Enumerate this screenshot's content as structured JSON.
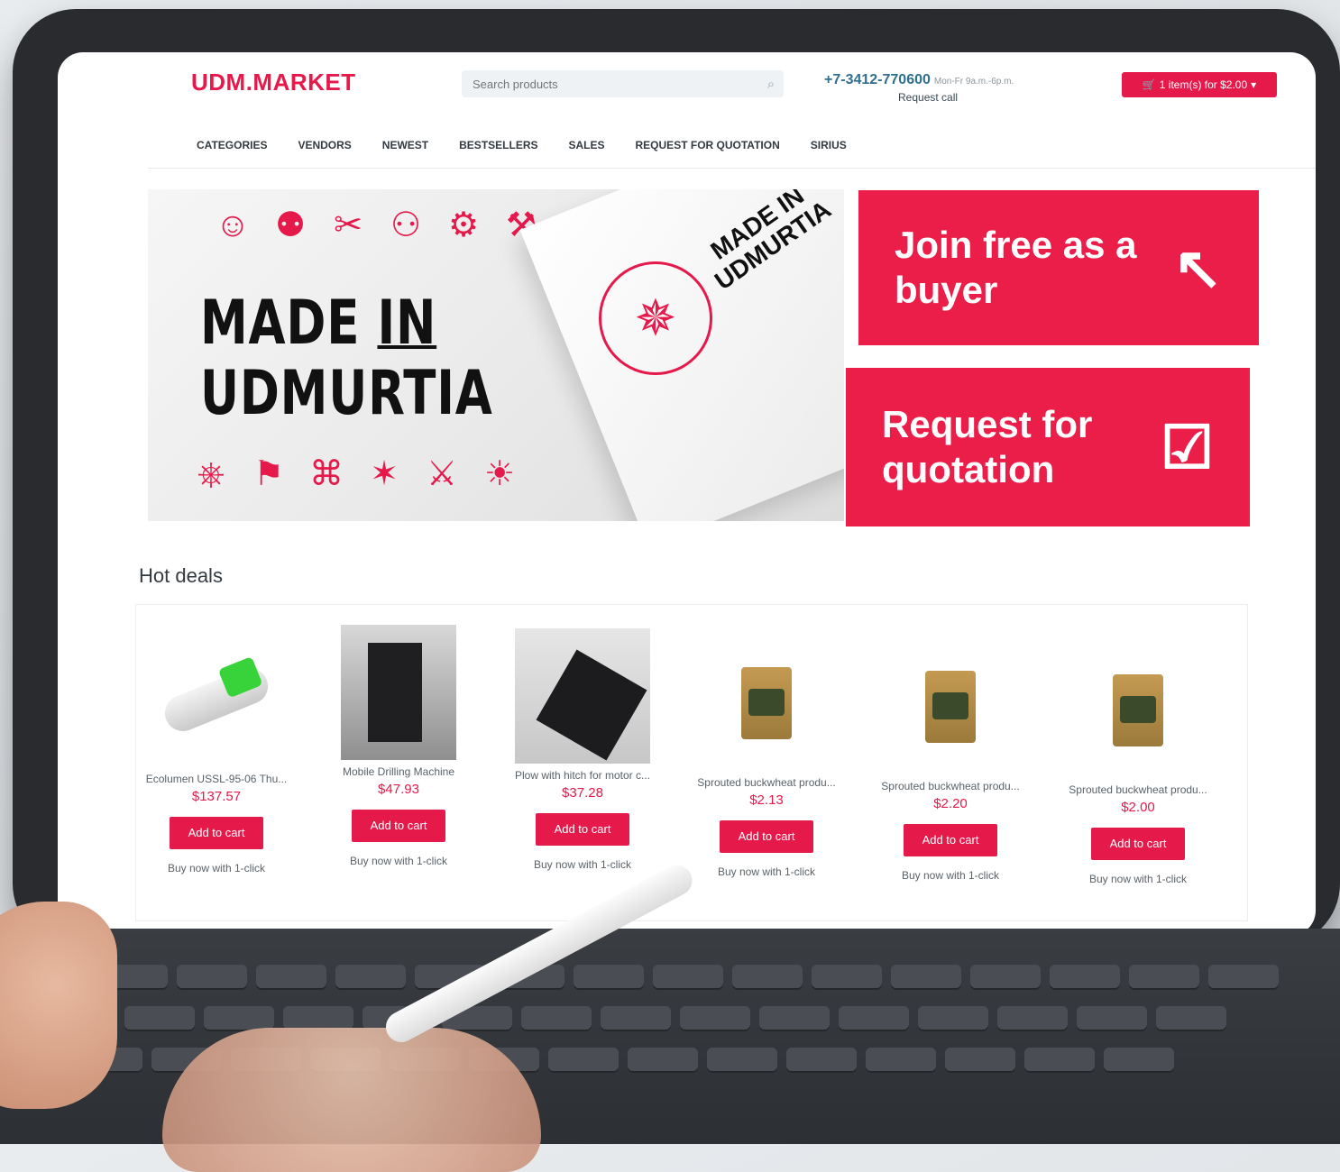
{
  "header": {
    "logo": "UDM.MARKET",
    "search_placeholder": "Search products",
    "phone": "+7-3412-770600",
    "hours": "Mon-Fr 9a.m.-6p.m.",
    "request_call": "Request call",
    "cart": "1 item(s) for $2.00"
  },
  "nav": [
    "CATEGORIES",
    "VENDORS",
    "NEWEST",
    "BESTSELLERS",
    "SALES",
    "REQUEST FOR QUOTATION",
    "SIRIUS"
  ],
  "banner": {
    "line1": "MADE",
    "in": "IN",
    "line2": "UDMURTIA",
    "box_text": "MADE IN\nUDMURTIA",
    "stamp_top": "MADE IN",
    "stamp_bottom": "UDMURTIA"
  },
  "promos": [
    {
      "text": "Join free as a buyer",
      "icon": "cursor-click-icon"
    },
    {
      "text": "Request for quotation",
      "icon": "checklist-icon"
    }
  ],
  "hot_deals": {
    "title": "Hot deals",
    "products": [
      {
        "name": "Ecolumen USSL-95-06 Thu...",
        "price": "$137.57",
        "button": "Add to cart",
        "buy": "Buy now with 1-click"
      },
      {
        "name": "Mobile Drilling Machine",
        "price": "$47.93",
        "button": "Add to cart",
        "buy": "Buy now with 1-click"
      },
      {
        "name": "Plow with hitch for motor c...",
        "price": "$37.28",
        "button": "Add to cart",
        "buy": "Buy now with 1-click"
      },
      {
        "name": "Sprouted buckwheat produ...",
        "price": "$2.13",
        "button": "Add to cart",
        "buy": "Buy now with 1-click"
      },
      {
        "name": "Sprouted buckwheat produ...",
        "price": "$2.20",
        "button": "Add to cart",
        "buy": "Buy now with 1-click"
      },
      {
        "name": "Sprouted buckwheat produ...",
        "price": "$2.00",
        "button": "Add to cart",
        "buy": "Buy now with 1-click"
      }
    ]
  },
  "colors": {
    "brand": "#e6194b",
    "promo": "#eb1e4a"
  }
}
